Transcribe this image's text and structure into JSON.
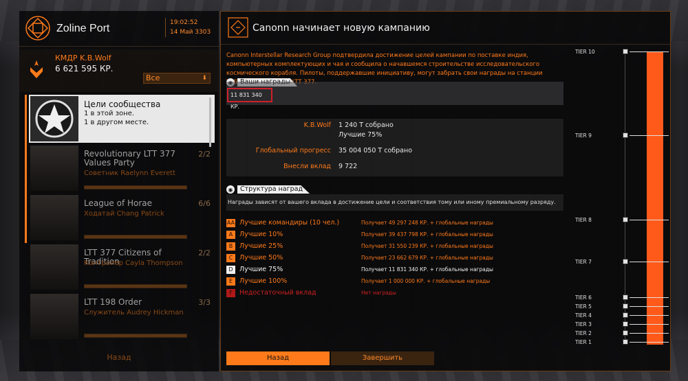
{
  "station": {
    "name": "Zoline Port",
    "time": "19:02:52",
    "date": "14 Май 3303"
  },
  "commander": {
    "name": "КМДР K.B.Wolf",
    "credits": "6 621 595 КР."
  },
  "filter": {
    "value": "Все"
  },
  "goals": [
    {
      "title": "Цели сообщества",
      "line1": "1 в этой зоне.",
      "line2": "1 в другом месте."
    },
    {
      "title": "Revolutionary LTT 377 Values Party",
      "sub": "Советник Raelynn Everett",
      "count": "2/2"
    },
    {
      "title": "League of Horae",
      "sub": "Ходатай Chang Patrick",
      "count": "6/6"
    },
    {
      "title": "LTT 377 Citizens of Tradition",
      "sub": "Контролер Cayla Thompson",
      "count": "2/2"
    },
    {
      "title": "LTT 198 Order",
      "sub": "Служитель Audrey Hickman",
      "count": "3/3"
    }
  ],
  "left_back": "Назад",
  "main": {
    "title": "Canonn начинает новую кампанию",
    "intro": "Canonn Interstellar Research Group подтвердила достижение целей кампании по поставке индия, компьютерных комплектующих и чая и сообщила о начавшемся строительстве исследовательского космического корабля. Пилоты, поддержавшие инициативу, могут забрать свои награды на станции Zoline Port в системе LTT 377.",
    "rewards_heading": "Ваши награды",
    "reward_value": "11 831 340 КР.",
    "stats": [
      {
        "label": "K.B.Wolf",
        "value": "1 240 Т собрано"
      },
      {
        "label": "",
        "value": "Лучшие 75%"
      },
      {
        "label": "Глобальный прогресс",
        "value": "35 004 050 Т собрано"
      },
      {
        "label": "Внесли вклад",
        "value": "9 722"
      }
    ],
    "structure_heading": "Структура наград",
    "structure_text": "Награды зависят от вашего вклада в достижение цели и соответствия тому или иному премиальному разряду.",
    "tiers": [
      {
        "badge": "AA",
        "name": "Лучшие командиры (10 чел.)",
        "reward": "Получает 49 297 248 КР. + глобальные награды",
        "style": "orange"
      },
      {
        "badge": "A",
        "name": "Лучшие 10%",
        "reward": "Получает 39 437 798 КР. + глобальные награды",
        "style": "orange"
      },
      {
        "badge": "B",
        "name": "Лучшие 25%",
        "reward": "Получает 31 550 239 КР. + глобальные награды",
        "style": "orange"
      },
      {
        "badge": "C",
        "name": "Лучшие 50%",
        "reward": "Получает 23 662 679 КР. + глобальные награды",
        "style": "orange"
      },
      {
        "badge": "D",
        "name": "Лучшие 75%",
        "reward": "Получает 11 831 340 КР. + глобальные награды",
        "style": "white"
      },
      {
        "badge": "E",
        "name": "Лучшие 100%",
        "reward": "Получает 1 000 000 КР. + глобальные награды",
        "style": "orange"
      },
      {
        "badge": "F",
        "name": "Недостаточный вклад",
        "reward": "Нет награды",
        "style": "red"
      }
    ],
    "back_button": "Назад",
    "finish_button": "Завершить"
  },
  "ladder": {
    "tiers": [
      "TIER 10",
      "TIER 9",
      "TIER 8",
      "TIER 7",
      "TIER 6",
      "TIER 5",
      "TIER 4",
      "TIER 3",
      "TIER 2",
      "TIER 1"
    ],
    "progress_fraction": 1.0
  },
  "colors": {
    "accent": "#ff7a1a",
    "highlight_border": "#d0202a",
    "danger": "#d02020"
  },
  "icons": {
    "station": "station-emblem-icon",
    "commander": "commander-rank-icon",
    "main": "campaign-diamond-icon",
    "section": "info-circle-icon",
    "ladder": "tier-marker-icon"
  }
}
